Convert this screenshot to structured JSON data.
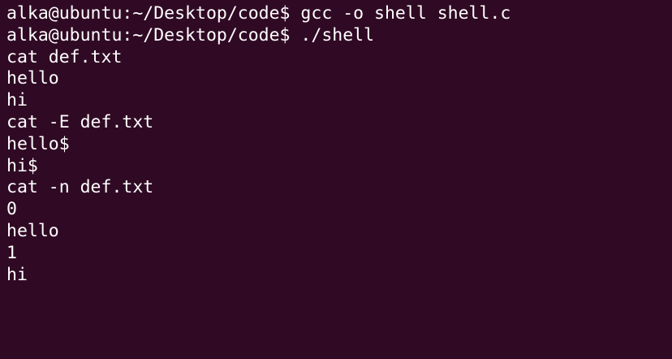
{
  "terminal": {
    "lines": [
      "alka@ubuntu:~/Desktop/code$ gcc -o shell shell.c",
      "alka@ubuntu:~/Desktop/code$ ./shell",
      "cat def.txt",
      "hello",
      "hi",
      "cat -E def.txt",
      "hello$",
      "hi$",
      "cat -n def.txt",
      "0",
      "hello",
      "1",
      "hi"
    ],
    "colors": {
      "background": "#300a24",
      "text": "#ffffff"
    }
  }
}
